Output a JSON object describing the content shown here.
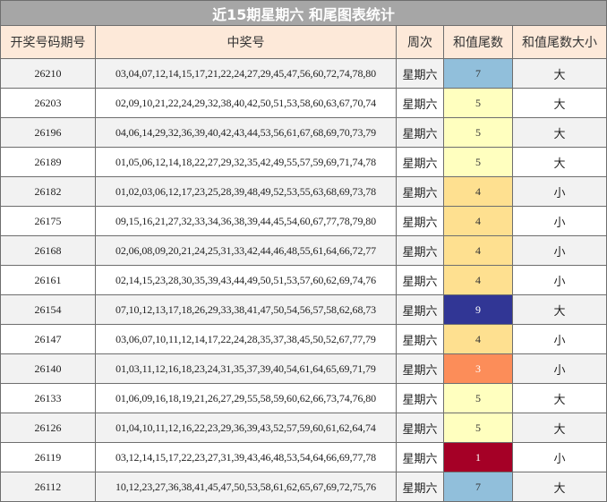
{
  "title": "近15期星期六 和尾图表统计",
  "headers": {
    "issue": "开奖号码期号",
    "numbers": "中奖号",
    "weekday": "周次",
    "tail": "和值尾数",
    "size": "和值尾数大小"
  },
  "tail_colors": {
    "1": "#a50026",
    "3": "#fc8d59",
    "4": "#fee090",
    "5": "#ffffbf",
    "7": "#91bfdb",
    "9": "#313695"
  },
  "tail_text_colors": {
    "1": "#ffffff",
    "3": "#ffffff",
    "4": "#333333",
    "5": "#333333",
    "7": "#333333",
    "9": "#ffffff"
  },
  "rows": [
    {
      "issue": "26210",
      "numbers": "03,04,07,12,14,15,17,21,22,24,27,29,45,47,56,60,72,74,78,80",
      "weekday": "星期六",
      "tail": "7",
      "size": "大"
    },
    {
      "issue": "26203",
      "numbers": "02,09,10,21,22,24,29,32,38,40,42,50,51,53,58,60,63,67,70,74",
      "weekday": "星期六",
      "tail": "5",
      "size": "大"
    },
    {
      "issue": "26196",
      "numbers": "04,06,14,29,32,36,39,40,42,43,44,53,56,61,67,68,69,70,73,79",
      "weekday": "星期六",
      "tail": "5",
      "size": "大"
    },
    {
      "issue": "26189",
      "numbers": "01,05,06,12,14,18,22,27,29,32,35,42,49,55,57,59,69,71,74,78",
      "weekday": "星期六",
      "tail": "5",
      "size": "大"
    },
    {
      "issue": "26182",
      "numbers": "01,02,03,06,12,17,23,25,28,39,48,49,52,53,55,63,68,69,73,78",
      "weekday": "星期六",
      "tail": "4",
      "size": "小"
    },
    {
      "issue": "26175",
      "numbers": "09,15,16,21,27,32,33,34,36,38,39,44,45,54,60,67,77,78,79,80",
      "weekday": "星期六",
      "tail": "4",
      "size": "小"
    },
    {
      "issue": "26168",
      "numbers": "02,06,08,09,20,21,24,25,31,33,42,44,46,48,55,61,64,66,72,77",
      "weekday": "星期六",
      "tail": "4",
      "size": "小"
    },
    {
      "issue": "26161",
      "numbers": "02,14,15,23,28,30,35,39,43,44,49,50,51,53,57,60,62,69,74,76",
      "weekday": "星期六",
      "tail": "4",
      "size": "小"
    },
    {
      "issue": "26154",
      "numbers": "07,10,12,13,17,18,26,29,33,38,41,47,50,54,56,57,58,62,68,73",
      "weekday": "星期六",
      "tail": "9",
      "size": "大"
    },
    {
      "issue": "26147",
      "numbers": "03,06,07,10,11,12,14,17,22,24,28,35,37,38,45,50,52,67,77,79",
      "weekday": "星期六",
      "tail": "4",
      "size": "小"
    },
    {
      "issue": "26140",
      "numbers": "01,03,11,12,16,18,23,24,31,35,37,39,40,54,61,64,65,69,71,79",
      "weekday": "星期六",
      "tail": "3",
      "size": "小"
    },
    {
      "issue": "26133",
      "numbers": "01,06,09,16,18,19,21,26,27,29,55,58,59,60,62,66,73,74,76,80",
      "weekday": "星期六",
      "tail": "5",
      "size": "大"
    },
    {
      "issue": "26126",
      "numbers": "01,04,10,11,12,16,22,23,29,36,39,43,52,57,59,60,61,62,64,74",
      "weekday": "星期六",
      "tail": "5",
      "size": "大"
    },
    {
      "issue": "26119",
      "numbers": "03,12,14,15,17,22,23,27,31,39,43,46,48,53,54,64,66,69,77,78",
      "weekday": "星期六",
      "tail": "1",
      "size": "小"
    },
    {
      "issue": "26112",
      "numbers": "10,12,23,27,36,38,41,45,47,50,53,58,61,62,65,67,69,72,75,76",
      "weekday": "星期六",
      "tail": "7",
      "size": "大"
    }
  ]
}
